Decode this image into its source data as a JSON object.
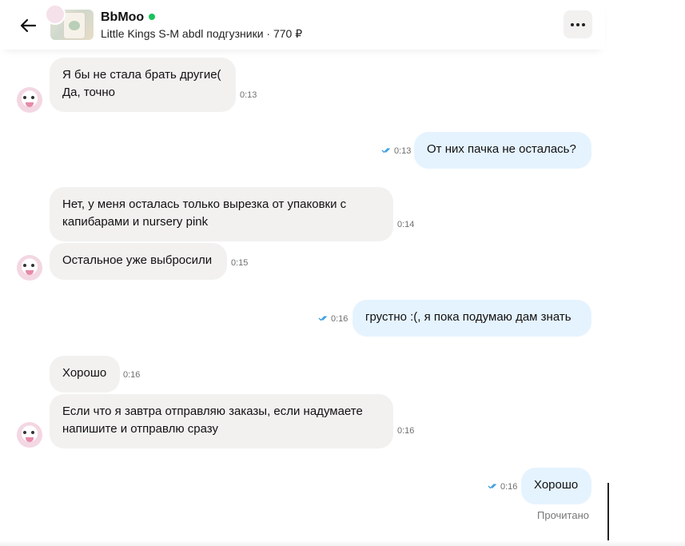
{
  "header": {
    "seller_name": "BbMoo",
    "product": "Little Kings S-M abdl подгузники · 770 ₽"
  },
  "messages": [
    {
      "dir": "in",
      "lines": [
        "Я бы не стала брать другие(",
        "Да, точно"
      ],
      "time": "0:13"
    },
    {
      "dir": "out",
      "lines": [
        "От них пачка не осталась?"
      ],
      "time": "0:13"
    },
    {
      "dir": "in",
      "lines": [
        "Нет, у меня осталась только вырезка от упаковки с",
        "капибарами и nursery pink"
      ],
      "time": "0:14"
    },
    {
      "dir": "in",
      "lines": [
        "Остальное уже выбросили"
      ],
      "time": "0:15"
    },
    {
      "dir": "out",
      "lines": [
        "грустно :(, я пока подумаю дам знать"
      ],
      "time": "0:16"
    },
    {
      "dir": "in",
      "lines": [
        "Хорошо"
      ],
      "time": "0:16"
    },
    {
      "dir": "in",
      "lines": [
        "Если что я завтра отправляю заказы, если надумаете",
        "напишите и отправлю сразу"
      ],
      "time": "0:16"
    },
    {
      "dir": "out",
      "lines": [
        "Хорошо"
      ],
      "time": "0:16"
    }
  ],
  "read_status": "Прочитано",
  "colors": {
    "incoming_bubble": "#f2f1f0",
    "outgoing_bubble": "#e5f3ff",
    "online": "#19c25a",
    "read_check": "#3a9be0"
  }
}
